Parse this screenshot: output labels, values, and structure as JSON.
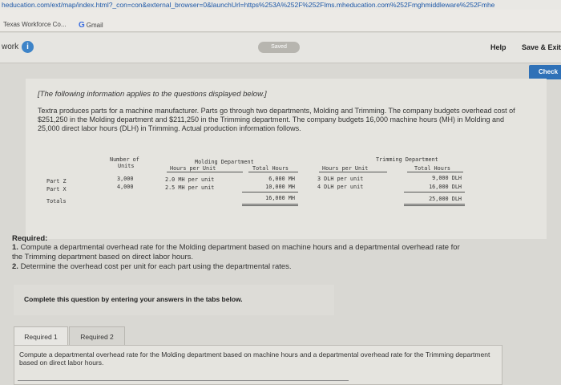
{
  "browser": {
    "url": "heducation.com/ext/map/index.html?_con=con&external_browser=0&launchUrl=https%253A%252F%252Flms.mheducation.com%252Fmghmiddleware%252Fmhe",
    "bookmarks": [
      "Texas Workforce Co...",
      "Gmail"
    ],
    "gmail_icon": "G"
  },
  "topbar": {
    "work_label": "work",
    "info_icon": "i",
    "saved_label": "Saved",
    "help_label": "Help",
    "save_exit_label": "Save & Exit",
    "check_label": "Check"
  },
  "problem": {
    "intro": "[The following information applies to the questions displayed below.]",
    "paragraph": "Textra produces parts for a machine manufacturer. Parts go through two departments, Molding and Trimming. The company budgets overhead cost of $251,250 in the Molding department and $211,250 in the Trimming department. The company budgets 16,000 machine hours (MH) in Molding and 25,000 direct labor hours (DLH) in Trimming. Actual production information follows."
  },
  "table": {
    "head_units_1": "Number of",
    "head_units_2": "Units",
    "molding_title": "Molding Department",
    "molding_col1": "Hours per Unit",
    "molding_col2": "Total Hours",
    "trimming_title": "Trimming Department",
    "trimming_col1": "Hours per Unit",
    "trimming_col2": "Total Hours",
    "rows": [
      {
        "label": "Part Z",
        "units": "3,000",
        "m_per": "2.0 MH per unit",
        "m_total": "6,000 MH",
        "t_per": "3 DLH per unit",
        "t_total": "9,000 DLH"
      },
      {
        "label": "Part X",
        "units": "4,000",
        "m_per": "2.5 MH per unit",
        "m_total": "10,000 MH",
        "t_per": "4 DLH per unit",
        "t_total": "16,000 DLH"
      }
    ],
    "totals": {
      "label": "Totals",
      "m_total": "16,000 MH",
      "t_total": "25,000 DLH"
    }
  },
  "required": {
    "heading": "Required:",
    "item1_num": "1.",
    "item1_text": "Compute a departmental overhead rate for the Molding department based on machine hours and a departmental overhead rate for",
    "item1_cont": "the Trimming department based on direct labor hours.",
    "item2_num": "2.",
    "item2_text": "Determine the overhead cost per unit for each part using the departmental rates."
  },
  "instructions": "Complete this question by entering your answers in the tabs below.",
  "tabs": [
    "Required 1",
    "Required 2"
  ],
  "task": "Compute a departmental overhead rate for the Molding department based on machine hours and a departmental overhead rate for the Trimming department based on direct labor hours."
}
